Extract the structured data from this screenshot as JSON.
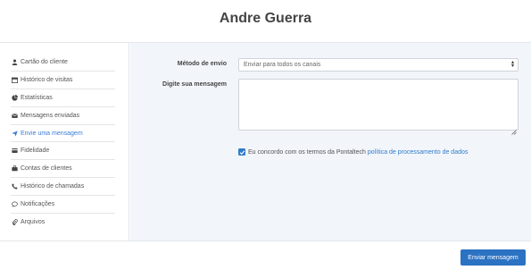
{
  "header": {
    "title": "Andre Guerra"
  },
  "sidebar": {
    "items": [
      {
        "label": "Cartão do cliente",
        "icon": "user-icon",
        "active": false
      },
      {
        "label": "Histórico de visitas",
        "icon": "calendar-icon",
        "active": false
      },
      {
        "label": "Estatísticas",
        "icon": "pie-chart-icon",
        "active": false
      },
      {
        "label": "Mensagens enviadas",
        "icon": "envelope-icon",
        "active": false
      },
      {
        "label": "Envie uma mensagem",
        "icon": "send-icon",
        "active": true
      },
      {
        "label": "Fidelidade",
        "icon": "credit-card-icon",
        "active": false
      },
      {
        "label": "Contas de clientes",
        "icon": "briefcase-icon",
        "active": false
      },
      {
        "label": "Histórico de chamadas",
        "icon": "phone-icon",
        "active": false
      },
      {
        "label": "Notificações",
        "icon": "comment-icon",
        "active": false
      },
      {
        "label": "Arquivos",
        "icon": "paperclip-icon",
        "active": false
      }
    ]
  },
  "form": {
    "method_label": "Método de envio",
    "method_value": "Enviar para todos os canais",
    "message_label": "Digite sua mensagem",
    "message_value": "",
    "consent_text": "Eu concordo com os termos da Pontaltech",
    "consent_link": "política de processamento de dados",
    "consent_checked": true
  },
  "actions": {
    "send_label": "Enviar mensagem"
  },
  "colors": {
    "accent": "#2b72c2",
    "active_link": "#3a7bd5",
    "panel_bg": "#f2f5fa"
  }
}
